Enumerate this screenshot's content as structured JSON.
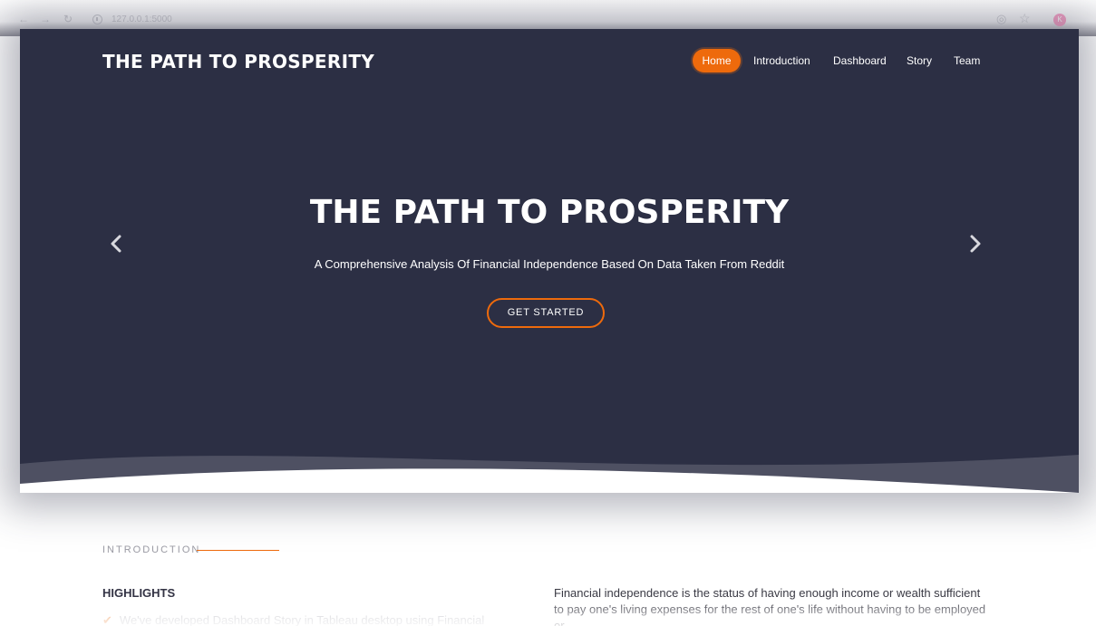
{
  "browser": {
    "url": "127.0.0.1:5000",
    "avatar_letter": "K",
    "icons": [
      "back-icon",
      "forward-icon",
      "reload-icon",
      "info-icon",
      "eye-off-icon",
      "star-icon"
    ]
  },
  "header": {
    "brand": "THE PATH TO PROSPERITY",
    "nav": [
      {
        "label": "Home",
        "active": true
      },
      {
        "label": "Introduction",
        "active": false
      },
      {
        "label": "Dashboard",
        "active": false
      },
      {
        "label": "Story",
        "active": false
      },
      {
        "label": "Team",
        "active": false
      }
    ]
  },
  "hero": {
    "title": "THE PATH TO PROSPERITY",
    "subtitle": "A Comprehensive Analysis Of Financial Independence Based On Data Taken From Reddit",
    "cta_label": "GET STARTED"
  },
  "intro": {
    "section_label": "INTRODUCTION",
    "highlights_heading": "HIGHLIGHTS",
    "highlight_item": "We've developed Dashboard Story in Tableau desktop using Financial",
    "paragraph": "Financial independence is the status of having enough income or wealth sufficient to pay one's living expenses for the rest of one's life without having to be employed or"
  },
  "colors": {
    "hero_bg": "#2c2f44",
    "accent": "#ee6a0c"
  }
}
